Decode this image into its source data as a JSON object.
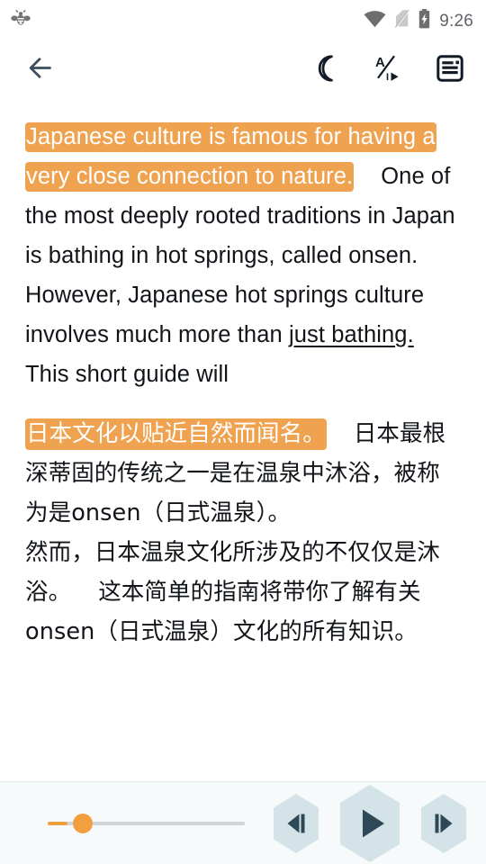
{
  "status_bar": {
    "app_icon": "bee-icon",
    "wifi_icon": "wifi-icon",
    "signal_icon": "no-sim-icon",
    "battery_icon": "battery-charging-icon",
    "clock": "9:26"
  },
  "toolbar": {
    "back_label": "back-arrow",
    "night_mode_label": "night-mode",
    "autoplay_label": "auto-read",
    "layout_label": "reading-layout"
  },
  "content": {
    "english": {
      "highlight": "Japanese culture is famous for having a very close connection to nature.",
      "segment2": "One of the most deeply rooted traditions in Japan is bathing in hot springs, called onsen. However, Japanese hot springs culture involves much more than",
      "underline": "just bathing.",
      "segment3": "This short guide will"
    },
    "chinese": {
      "highlight": "日本文化以贴近自然而闻名。",
      "segment2": "日本最根深蒂固的传统之一是在温泉中沐浴，被称为是onsen（日式温泉）。",
      "segment3": "然而，日本温泉文化所涉及的不仅仅是沐浴。",
      "segment4": "这本简单的指南将带你了解有关onsen（日式温泉）文化的所有知识。"
    }
  },
  "player": {
    "speed_slider": {
      "name": "playback-speed-slider",
      "value": 12,
      "min": 0,
      "max": 100
    },
    "prev_label": "previous-sentence",
    "play_label": "play",
    "next_label": "next-sentence"
  },
  "colors": {
    "highlight": "#efa24f",
    "accent": "#f2a03f",
    "control_bg": "#d4e3e7",
    "control_fg": "#2f4858",
    "player_bg": "#f6fafb",
    "text": "#111418",
    "toolbar_icon": "#131c26",
    "back_icon": "#3b4c5e",
    "status_icon": "#707070"
  }
}
